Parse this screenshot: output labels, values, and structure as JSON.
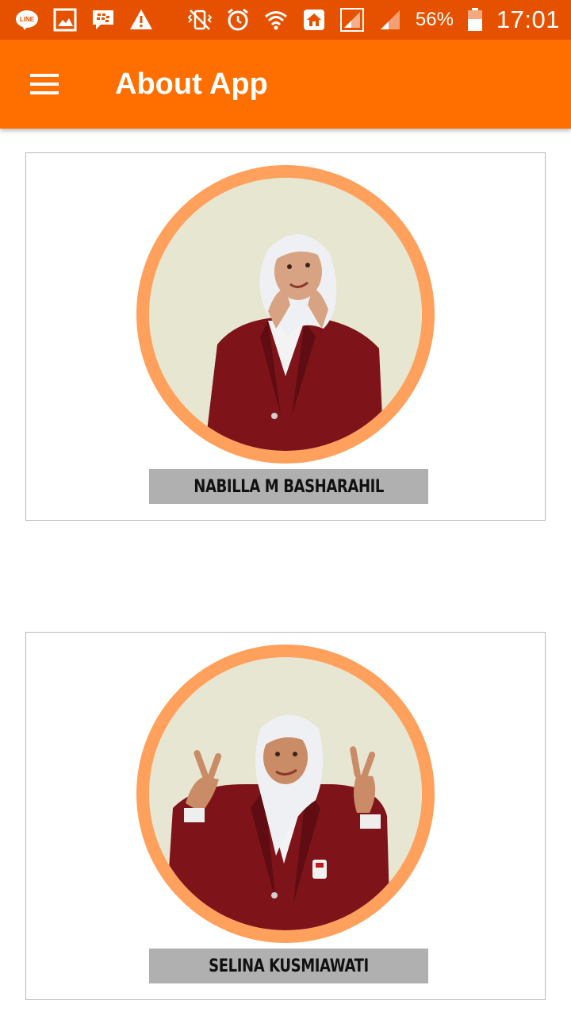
{
  "status_bar": {
    "battery_percent": "56%",
    "time": "17:01",
    "icons_left": [
      "line-icon",
      "gallery-icon",
      "bbm-icon",
      "warning-icon"
    ],
    "icons_right": [
      "vibrate-icon",
      "alarm-icon",
      "wifi-icon",
      "home-icon",
      "signal-icon",
      "signal-2-icon",
      "battery-icon"
    ]
  },
  "app_bar": {
    "title": "About App",
    "menu_icon": "hamburger-menu-icon",
    "background": "#ff6f00"
  },
  "colors": {
    "status_bar": "#e65100",
    "accent": "#ff6f00",
    "photo_ring": "#ffa05c",
    "name_plate": "#b0b0b0"
  },
  "members": [
    {
      "name": "NABILLA M BASHARAHIL"
    },
    {
      "name": "SELINA KUSMIAWATI"
    }
  ]
}
